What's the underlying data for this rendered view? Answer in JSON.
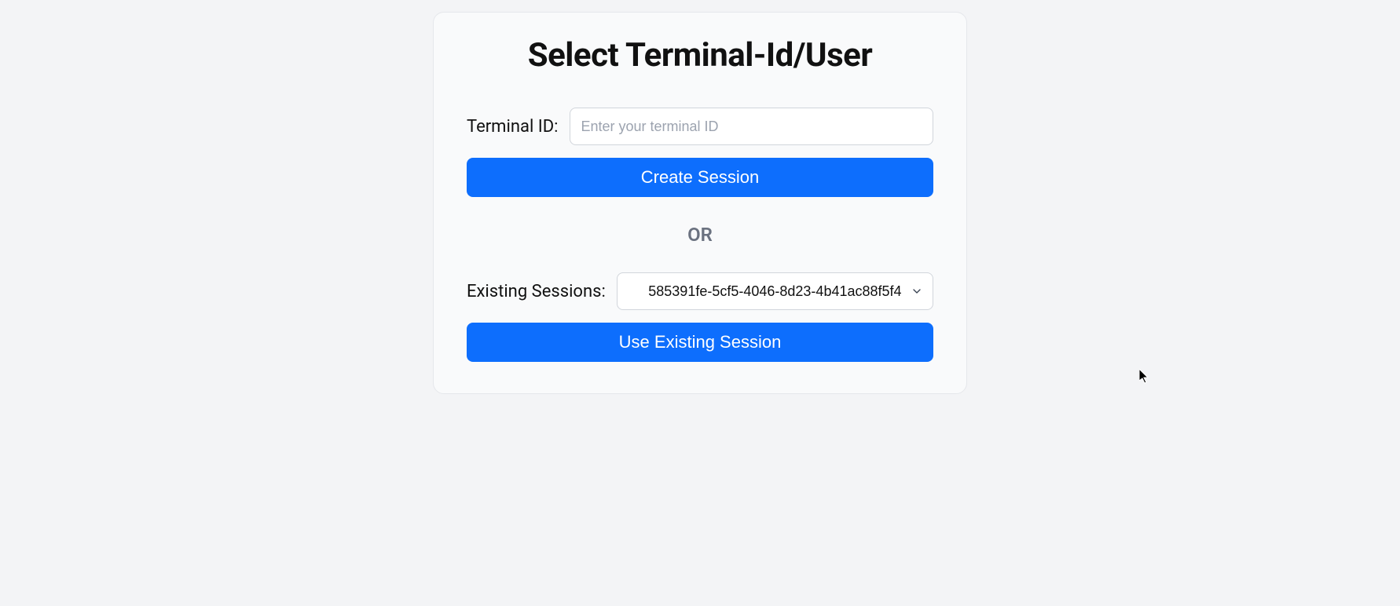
{
  "header": {
    "title": "Select Terminal-Id/User"
  },
  "terminal": {
    "label": "Terminal ID:",
    "placeholder": "Enter your terminal ID",
    "value": ""
  },
  "buttons": {
    "create_session": "Create Session",
    "use_existing": "Use Existing Session"
  },
  "separator": "OR",
  "existing": {
    "label": "Existing Sessions:",
    "selected": "585391fe-5cf5-4046-8d23-4b41ac88f5f4"
  }
}
